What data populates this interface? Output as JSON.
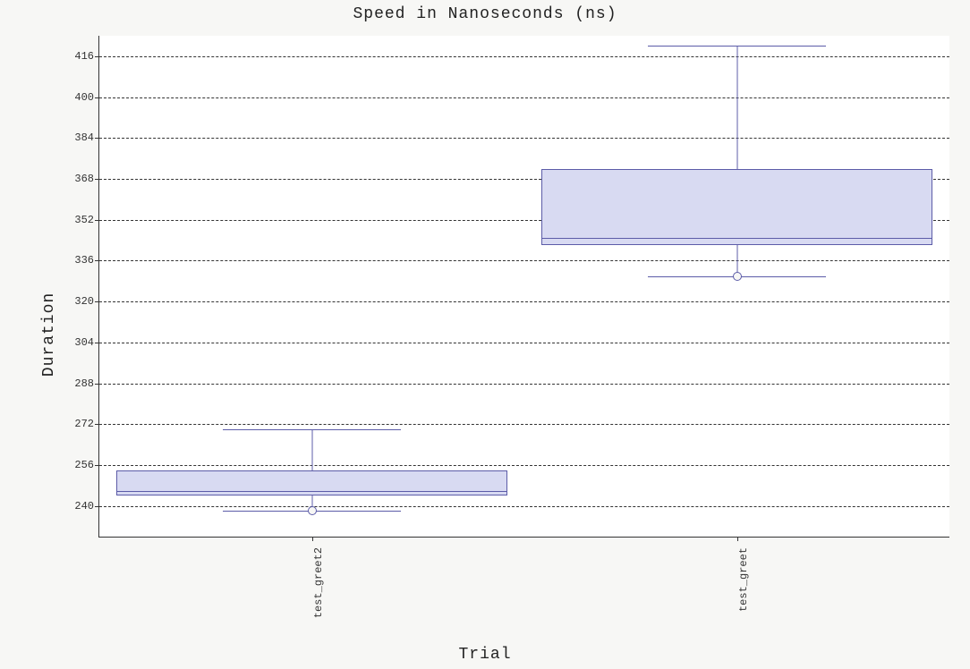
{
  "title": "Speed in Nanoseconds (ns)",
  "xlabel": "Trial",
  "ylabel": "Duration",
  "chart_data": {
    "type": "boxplot",
    "ylim": [
      228,
      424
    ],
    "yticks": [
      240,
      256,
      272,
      288,
      304,
      320,
      336,
      352,
      368,
      384,
      400,
      416
    ],
    "categories": [
      "test_greet2",
      "test_greet"
    ],
    "series": [
      {
        "name": "test_greet2",
        "lower_whisker": 238,
        "q1": 244,
        "median": 246,
        "q3": 254,
        "upper_whisker": 270,
        "outliers": [
          238
        ]
      },
      {
        "name": "test_greet",
        "lower_whisker": 330,
        "q1": 342,
        "median": 345,
        "q3": 372,
        "upper_whisker": 420,
        "outliers": [
          330
        ]
      }
    ],
    "grid": true
  }
}
